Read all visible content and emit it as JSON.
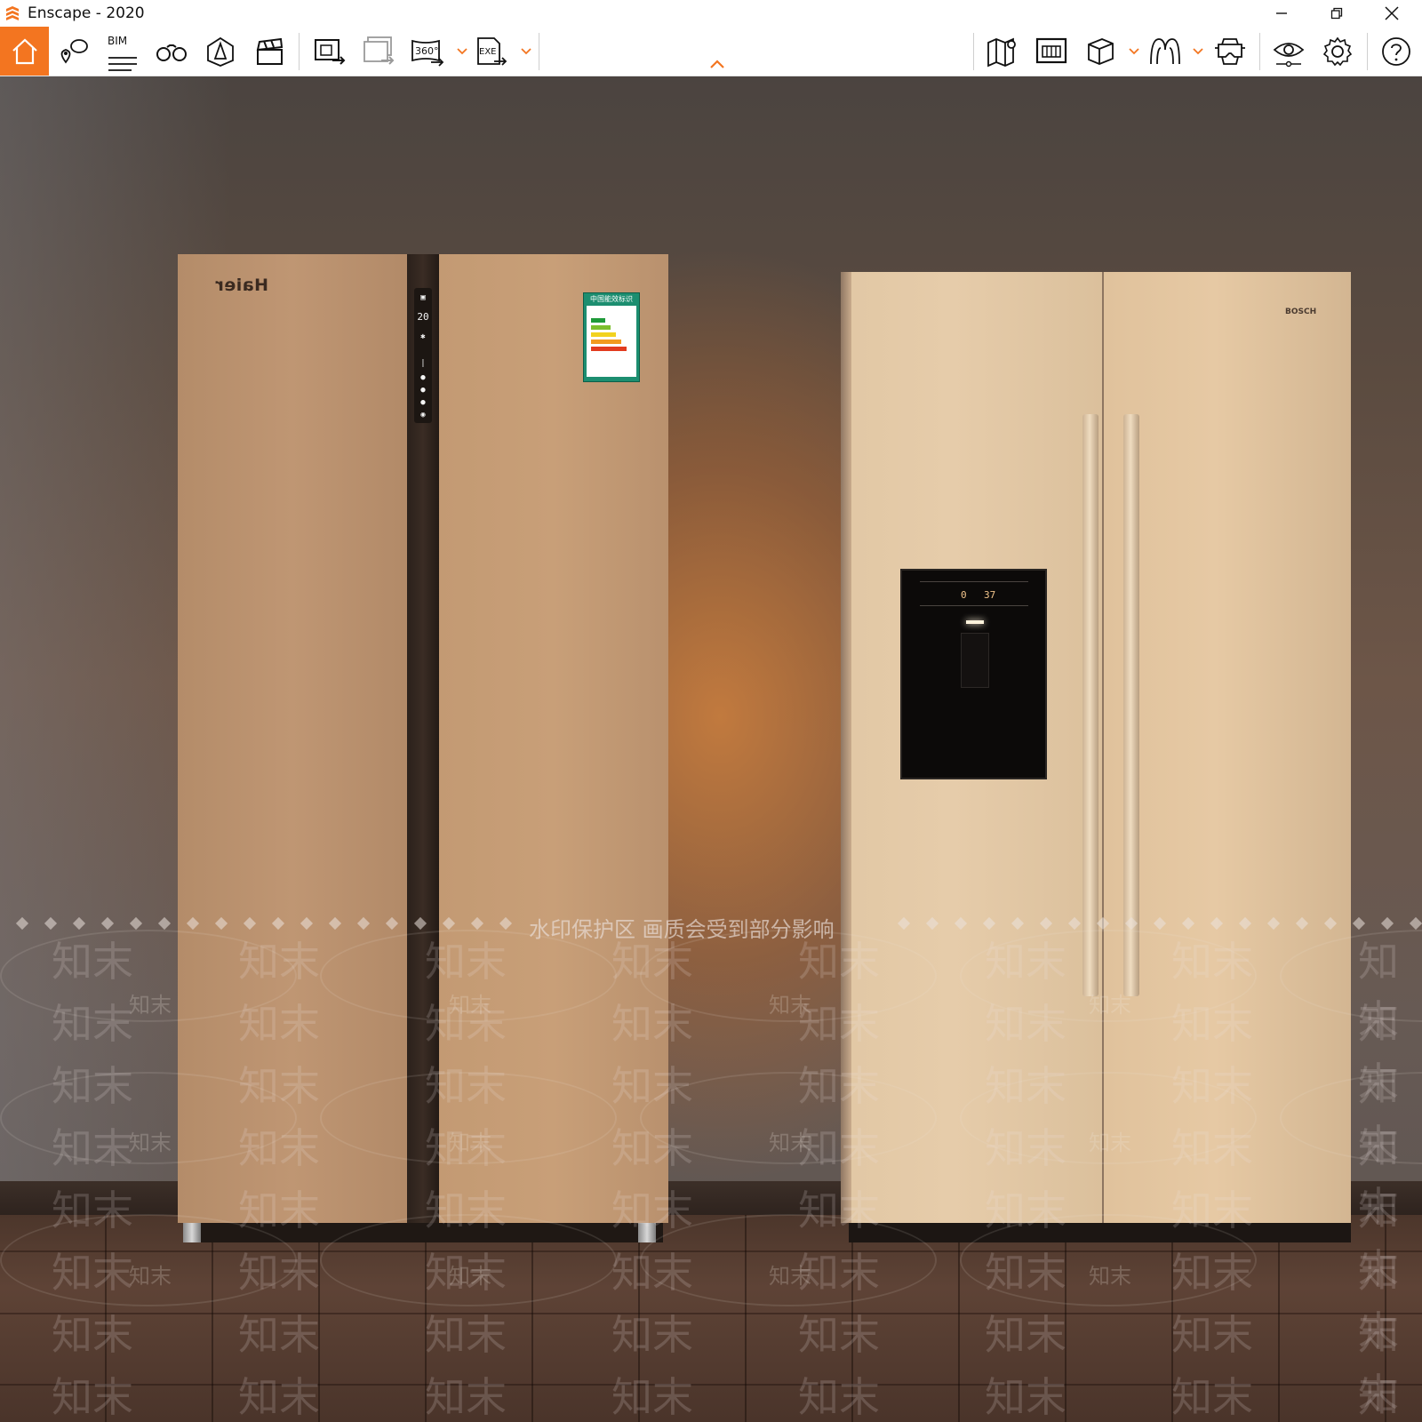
{
  "window": {
    "title": "Enscape - 2020",
    "minimize_icon": "minimize-icon",
    "restore_icon": "restore-icon",
    "close_icon": "close-icon"
  },
  "toolbar": {
    "accent_color": "#f37520",
    "left_tools": [
      {
        "name": "home",
        "icon": "home-icon"
      },
      {
        "name": "views",
        "icon": "map-pin-bubble-icon"
      },
      {
        "name": "bim",
        "icon": "bim-icon",
        "label": "BIM"
      },
      {
        "name": "walk-mode",
        "icon": "binoculars-icon"
      },
      {
        "name": "render-mode",
        "icon": "cone-light-icon"
      },
      {
        "name": "video-editor",
        "icon": "clapperboard-icon"
      }
    ],
    "export_tools": [
      {
        "name": "screenshot",
        "icon": "export-image-icon"
      },
      {
        "name": "batch-render",
        "icon": "batch-export-icon"
      },
      {
        "name": "panorama",
        "icon": "panorama-360-icon",
        "label": "360°"
      },
      {
        "name": "standalone",
        "icon": "export-exe-icon",
        "label": "EXE"
      }
    ],
    "right_tools": [
      {
        "name": "map",
        "icon": "map-icon"
      },
      {
        "name": "asset-library",
        "icon": "asset-library-icon"
      },
      {
        "name": "material-editor",
        "icon": "cube-icon"
      },
      {
        "name": "atmosphere",
        "icon": "character-icon"
      },
      {
        "name": "vr",
        "icon": "vr-headset-icon"
      },
      {
        "name": "visual-settings",
        "icon": "eye-icon"
      },
      {
        "name": "settings",
        "icon": "gear-icon"
      },
      {
        "name": "help",
        "icon": "help-icon"
      }
    ],
    "collapse_icon": "chevron-up-icon"
  },
  "scene": {
    "haier": {
      "brand": "Haier",
      "energy_label_title": "中国能效标识"
    },
    "bosch": {
      "brand": "BOSCH",
      "display_left": "0",
      "display_right": "37"
    }
  },
  "watermark": {
    "banner": "水印保护区  画质会受到部分影响",
    "tile": "知末"
  }
}
